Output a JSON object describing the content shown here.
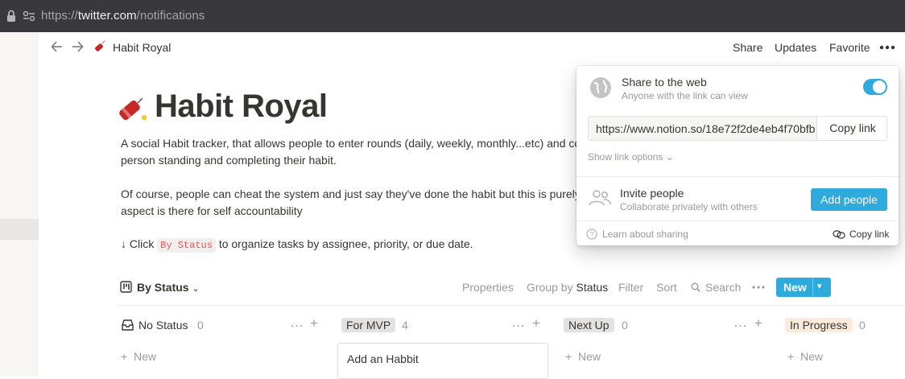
{
  "browser": {
    "url_scheme": "https://",
    "url_host": "twitter.com",
    "url_path": "/notifications"
  },
  "topbar": {
    "page_emoji": "firecracker-icon",
    "breadcrumb": "Habit Royal",
    "share": "Share",
    "updates": "Updates",
    "favorite": "Favorite"
  },
  "page": {
    "title": "Habit Royal",
    "desc1_line1": "A social Habit tracker, that allows people to enter rounds (daily, weekly, monthly...etc) and com",
    "desc1_line2": "person standing and completing their habit.",
    "desc2_line1": "Of course, people can cheat the system and just say they've done the habit but this is purely",
    "desc2_line2": "aspect is there for self accountability",
    "hint_prefix": "↓ Click",
    "hint_code": "By Status",
    "hint_suffix": "to organize tasks by assignee, priority, or due date."
  },
  "board": {
    "view_name": "By Status",
    "properties": "Properties",
    "group_by_prefix": "Group by",
    "group_by_value": "Status",
    "filter": "Filter",
    "sort": "Sort",
    "search": "Search",
    "new_label": "New",
    "columns": [
      {
        "name": "No Status",
        "count": "0",
        "new": "New"
      },
      {
        "name": "For MVP",
        "count": "4",
        "card": "Add an Habbit",
        "color": "#e3e2e0"
      },
      {
        "name": "Next Up",
        "count": "0",
        "new": "New",
        "color": "#e3e2e0"
      },
      {
        "name": "In Progress",
        "count": "0",
        "new": "New",
        "color": "#faebdd"
      }
    ]
  },
  "share_popover": {
    "title": "Share to the web",
    "subtitle": "Anyone with the link can view",
    "toggle_on": true,
    "link": "https://www.notion.so/18e72f2de4eb4f70bfb",
    "copy_link": "Copy link",
    "show_options": "Show link options",
    "invite_title": "Invite people",
    "invite_subtitle": "Collaborate privately with others",
    "add_people": "Add people",
    "learn": "Learn about sharing",
    "footer_copy": "Copy link"
  },
  "colors": {
    "accent": "#2eaadc",
    "text": "#37352f",
    "muted": "#9b9a97"
  }
}
